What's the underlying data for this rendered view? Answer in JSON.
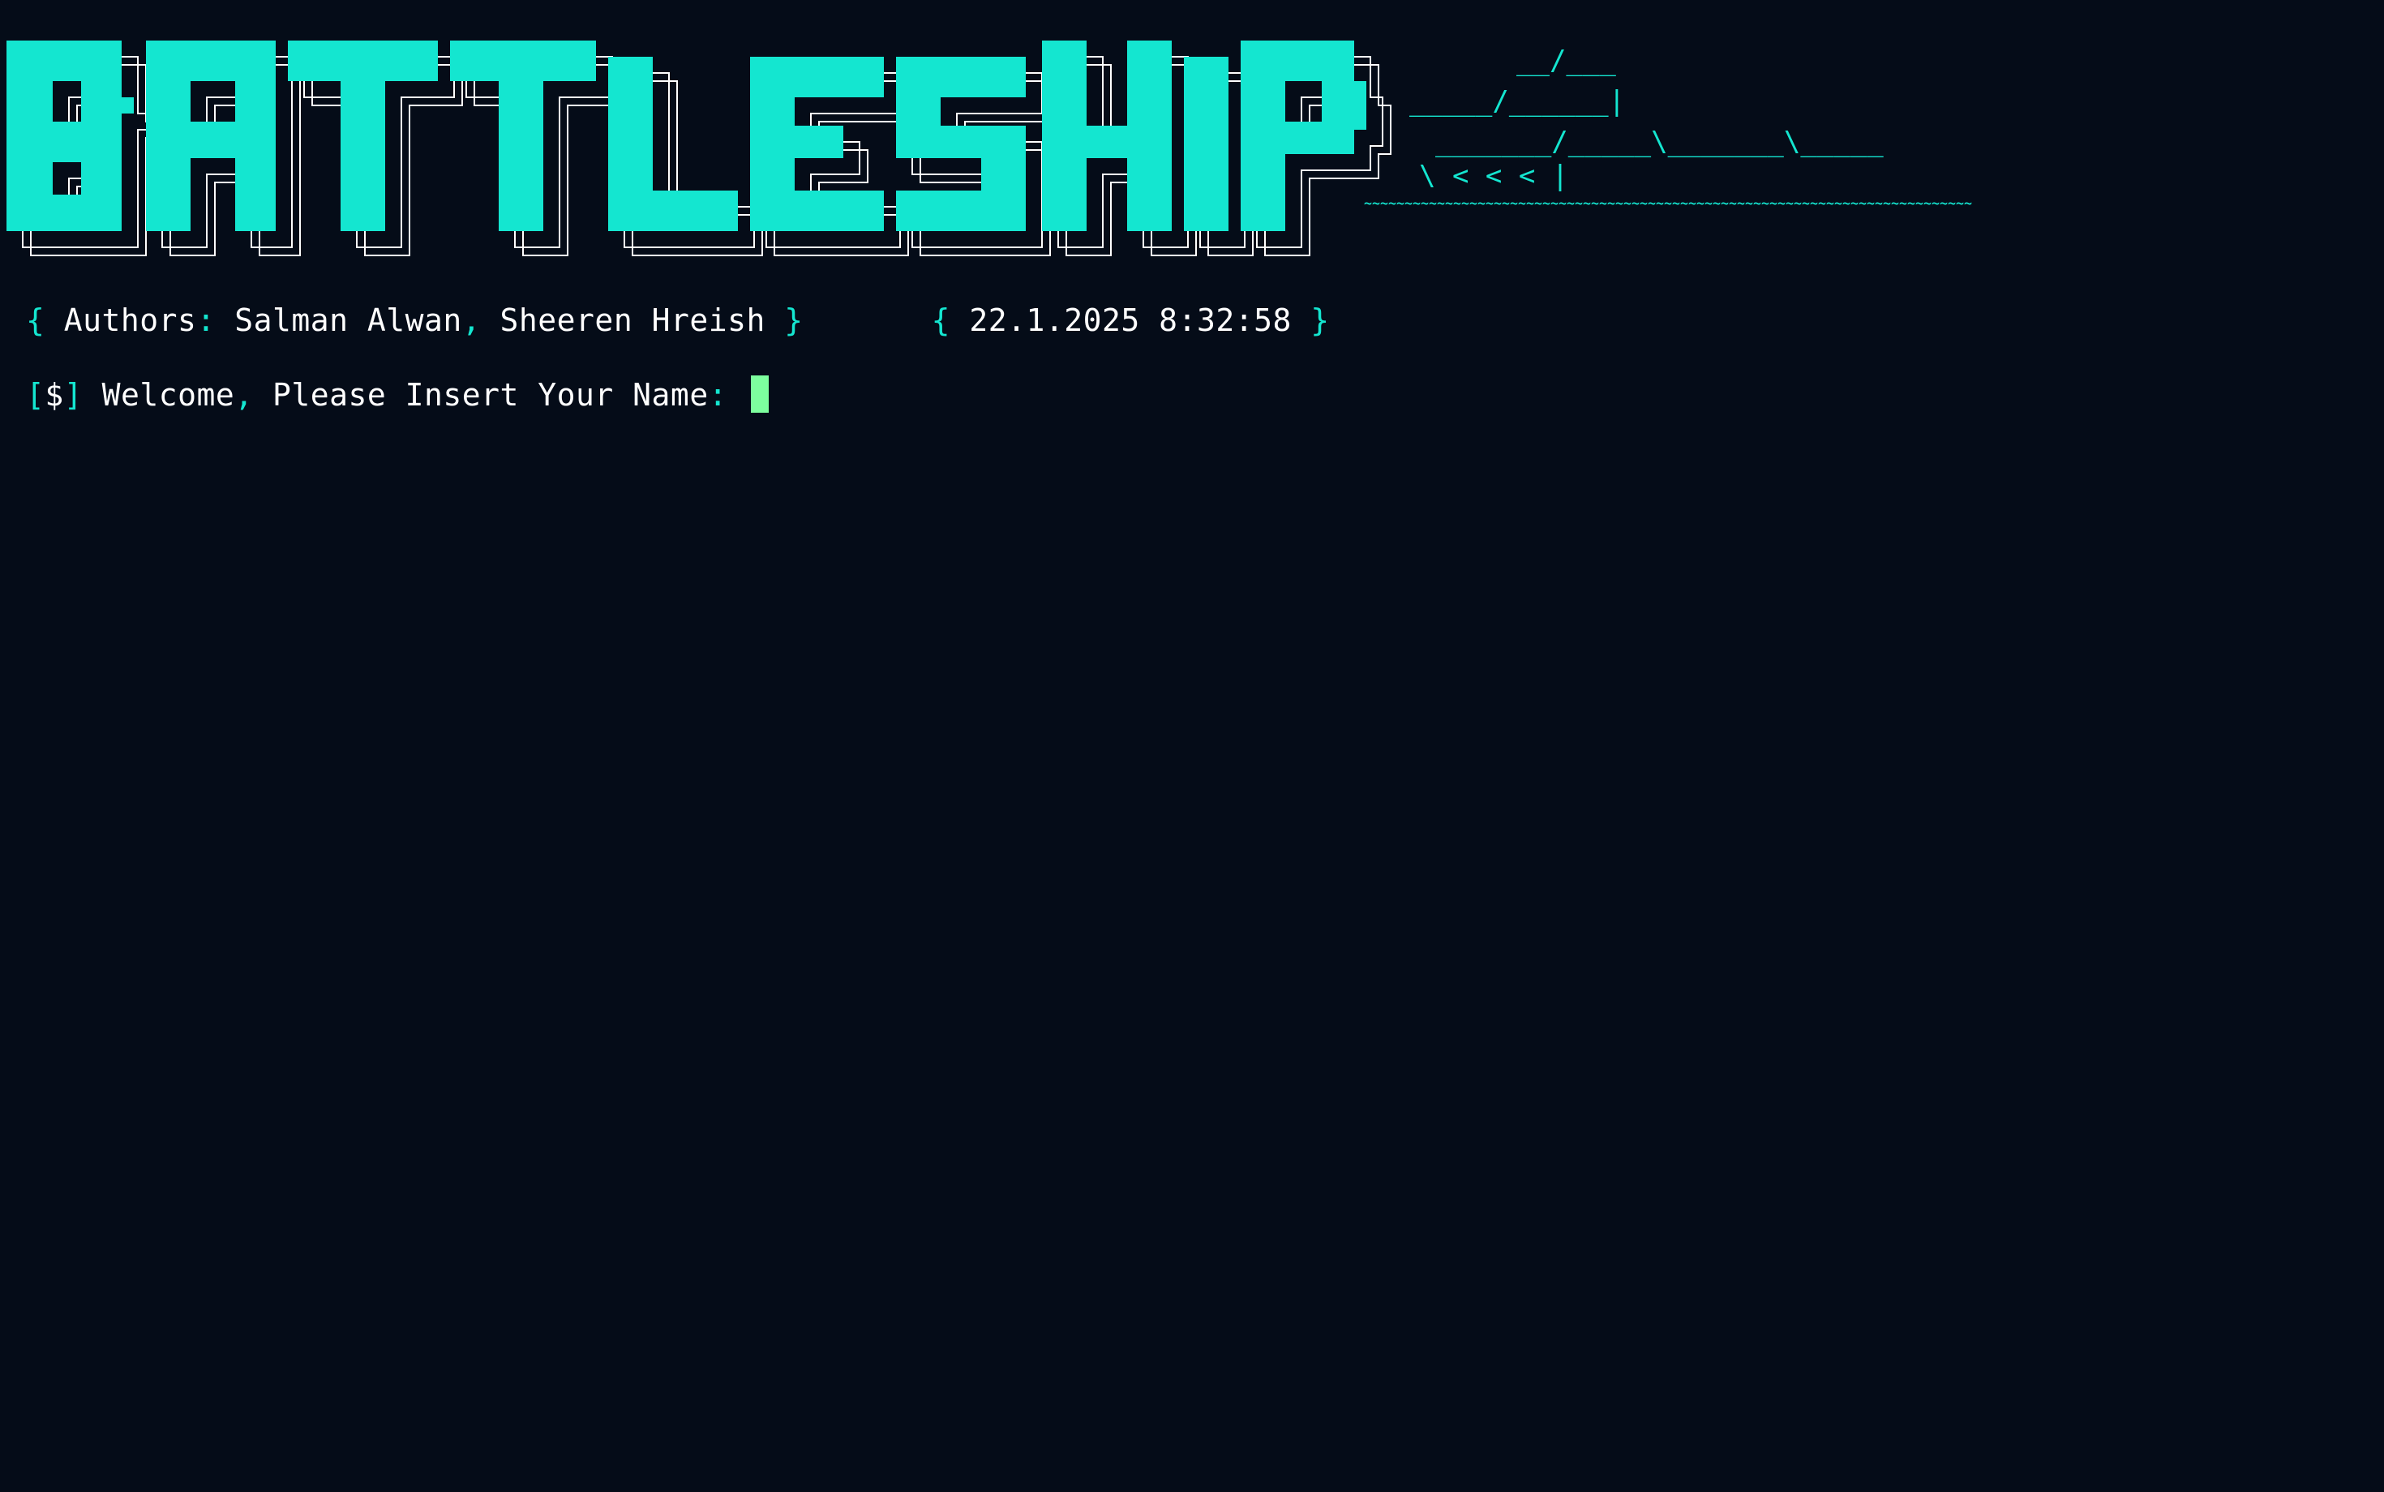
{
  "app": {
    "title": "BATTLESHIP"
  },
  "colors": {
    "background": "#050c18",
    "accent": "#14e6d0",
    "text": "#ffffff",
    "cursor": "#7dff9e"
  },
  "ship_art": {
    "lines": [
      "        __/___",
      "   _____/______|",
      "_______/_____\\_______\\_____",
      "\\              < < <       |",
      "~~~~~~~~~~~~~~~~~~~~~~~~~~~~~~~~~~~~~~~~~~~~~~~~~~~~~~~~~~~~~~~~~~~~~~~~~~~"
    ]
  },
  "header": {
    "brace_open": "{",
    "authors_label": "Authors",
    "colon": ":",
    "author_1": "Salman Alwan",
    "comma": ",",
    "author_2": "Sheeren Hreish",
    "brace_close": "}",
    "date_brace_open": "{",
    "datetime": "22.1.2025 8:32:58",
    "date_brace_close": "}"
  },
  "prompt": {
    "bracket_open": "[",
    "symbol": "$",
    "bracket_close": "]",
    "text_1": "Welcome",
    "comma": ",",
    "text_2": "Please Insert Your Name",
    "colon": ":",
    "input_value": ""
  }
}
